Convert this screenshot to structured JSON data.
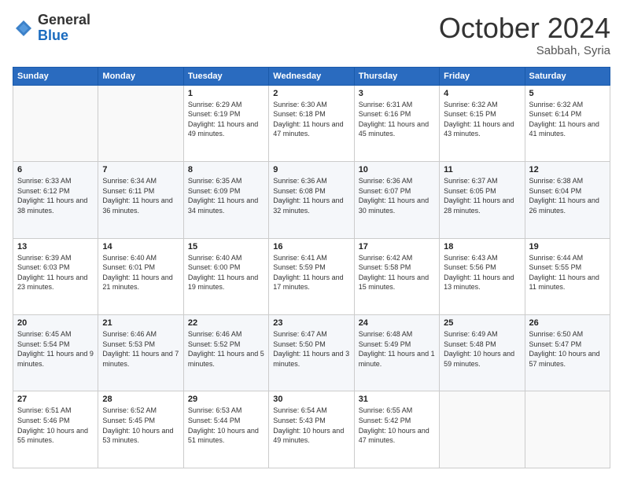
{
  "logo": {
    "general": "General",
    "blue": "Blue"
  },
  "header": {
    "month": "October 2024",
    "location": "Sabbah, Syria"
  },
  "weekdays": [
    "Sunday",
    "Monday",
    "Tuesday",
    "Wednesday",
    "Thursday",
    "Friday",
    "Saturday"
  ],
  "weeks": [
    [
      {
        "day": "",
        "info": ""
      },
      {
        "day": "",
        "info": ""
      },
      {
        "day": "1",
        "info": "Sunrise: 6:29 AM\nSunset: 6:19 PM\nDaylight: 11 hours and 49 minutes."
      },
      {
        "day": "2",
        "info": "Sunrise: 6:30 AM\nSunset: 6:18 PM\nDaylight: 11 hours and 47 minutes."
      },
      {
        "day": "3",
        "info": "Sunrise: 6:31 AM\nSunset: 6:16 PM\nDaylight: 11 hours and 45 minutes."
      },
      {
        "day": "4",
        "info": "Sunrise: 6:32 AM\nSunset: 6:15 PM\nDaylight: 11 hours and 43 minutes."
      },
      {
        "day": "5",
        "info": "Sunrise: 6:32 AM\nSunset: 6:14 PM\nDaylight: 11 hours and 41 minutes."
      }
    ],
    [
      {
        "day": "6",
        "info": "Sunrise: 6:33 AM\nSunset: 6:12 PM\nDaylight: 11 hours and 38 minutes."
      },
      {
        "day": "7",
        "info": "Sunrise: 6:34 AM\nSunset: 6:11 PM\nDaylight: 11 hours and 36 minutes."
      },
      {
        "day": "8",
        "info": "Sunrise: 6:35 AM\nSunset: 6:09 PM\nDaylight: 11 hours and 34 minutes."
      },
      {
        "day": "9",
        "info": "Sunrise: 6:36 AM\nSunset: 6:08 PM\nDaylight: 11 hours and 32 minutes."
      },
      {
        "day": "10",
        "info": "Sunrise: 6:36 AM\nSunset: 6:07 PM\nDaylight: 11 hours and 30 minutes."
      },
      {
        "day": "11",
        "info": "Sunrise: 6:37 AM\nSunset: 6:05 PM\nDaylight: 11 hours and 28 minutes."
      },
      {
        "day": "12",
        "info": "Sunrise: 6:38 AM\nSunset: 6:04 PM\nDaylight: 11 hours and 26 minutes."
      }
    ],
    [
      {
        "day": "13",
        "info": "Sunrise: 6:39 AM\nSunset: 6:03 PM\nDaylight: 11 hours and 23 minutes."
      },
      {
        "day": "14",
        "info": "Sunrise: 6:40 AM\nSunset: 6:01 PM\nDaylight: 11 hours and 21 minutes."
      },
      {
        "day": "15",
        "info": "Sunrise: 6:40 AM\nSunset: 6:00 PM\nDaylight: 11 hours and 19 minutes."
      },
      {
        "day": "16",
        "info": "Sunrise: 6:41 AM\nSunset: 5:59 PM\nDaylight: 11 hours and 17 minutes."
      },
      {
        "day": "17",
        "info": "Sunrise: 6:42 AM\nSunset: 5:58 PM\nDaylight: 11 hours and 15 minutes."
      },
      {
        "day": "18",
        "info": "Sunrise: 6:43 AM\nSunset: 5:56 PM\nDaylight: 11 hours and 13 minutes."
      },
      {
        "day": "19",
        "info": "Sunrise: 6:44 AM\nSunset: 5:55 PM\nDaylight: 11 hours and 11 minutes."
      }
    ],
    [
      {
        "day": "20",
        "info": "Sunrise: 6:45 AM\nSunset: 5:54 PM\nDaylight: 11 hours and 9 minutes."
      },
      {
        "day": "21",
        "info": "Sunrise: 6:46 AM\nSunset: 5:53 PM\nDaylight: 11 hours and 7 minutes."
      },
      {
        "day": "22",
        "info": "Sunrise: 6:46 AM\nSunset: 5:52 PM\nDaylight: 11 hours and 5 minutes."
      },
      {
        "day": "23",
        "info": "Sunrise: 6:47 AM\nSunset: 5:50 PM\nDaylight: 11 hours and 3 minutes."
      },
      {
        "day": "24",
        "info": "Sunrise: 6:48 AM\nSunset: 5:49 PM\nDaylight: 11 hours and 1 minute."
      },
      {
        "day": "25",
        "info": "Sunrise: 6:49 AM\nSunset: 5:48 PM\nDaylight: 10 hours and 59 minutes."
      },
      {
        "day": "26",
        "info": "Sunrise: 6:50 AM\nSunset: 5:47 PM\nDaylight: 10 hours and 57 minutes."
      }
    ],
    [
      {
        "day": "27",
        "info": "Sunrise: 6:51 AM\nSunset: 5:46 PM\nDaylight: 10 hours and 55 minutes."
      },
      {
        "day": "28",
        "info": "Sunrise: 6:52 AM\nSunset: 5:45 PM\nDaylight: 10 hours and 53 minutes."
      },
      {
        "day": "29",
        "info": "Sunrise: 6:53 AM\nSunset: 5:44 PM\nDaylight: 10 hours and 51 minutes."
      },
      {
        "day": "30",
        "info": "Sunrise: 6:54 AM\nSunset: 5:43 PM\nDaylight: 10 hours and 49 minutes."
      },
      {
        "day": "31",
        "info": "Sunrise: 6:55 AM\nSunset: 5:42 PM\nDaylight: 10 hours and 47 minutes."
      },
      {
        "day": "",
        "info": ""
      },
      {
        "day": "",
        "info": ""
      }
    ]
  ]
}
